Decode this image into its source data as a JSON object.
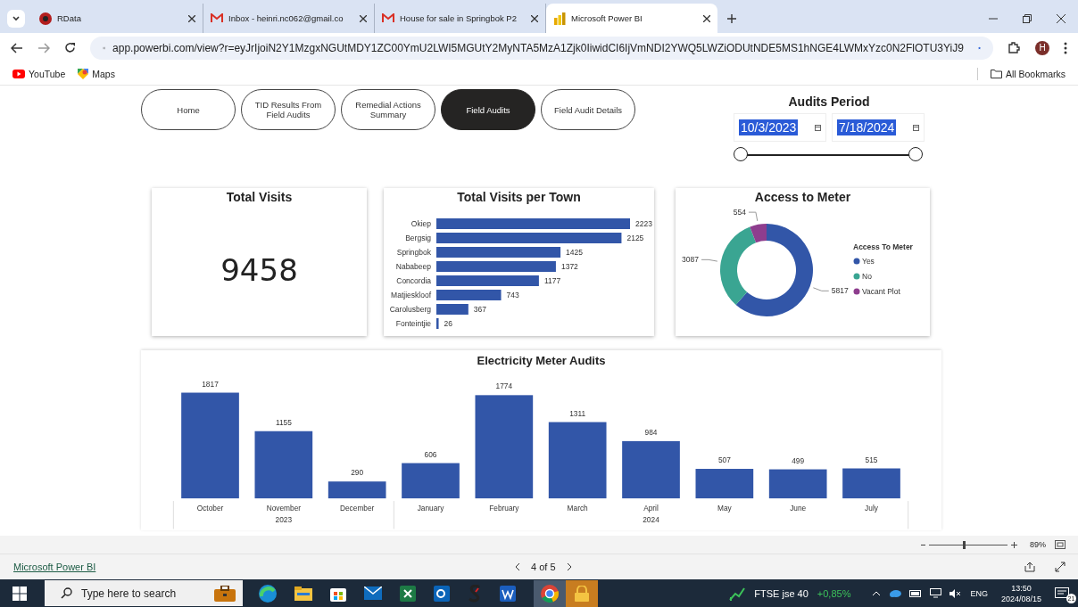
{
  "browser": {
    "tabs": [
      {
        "title": "RData",
        "selected": false
      },
      {
        "title": "Inbox - heinri.nc062@gmail.co",
        "selected": false
      },
      {
        "title": "House for sale in Springbok P2",
        "selected": false
      },
      {
        "title": "Microsoft Power BI",
        "selected": true
      }
    ],
    "url": "app.powerbi.com/view?r=eyJrIjoiN2Y1MzgxNGUtMDY1ZC00YmU2LWI5MGUtY2MyNTA5MzA1Zjk0IiwidCI6IjVmNDI2YWQ5LWZiODUtNDE5MS1hNGE4LWMxYzc0N2FlOTU3YiJ9",
    "profile_initial": "H",
    "bookmarks": [
      {
        "label": "YouTube"
      },
      {
        "label": "Maps"
      }
    ],
    "all_bookmarks": "All Bookmarks"
  },
  "nav_buttons": [
    {
      "label": "Home",
      "selected": false
    },
    {
      "label": "TID Results From Field Audits",
      "selected": false
    },
    {
      "label": "Remedial Actions Summary",
      "selected": false
    },
    {
      "label": "Field Audits",
      "selected": true
    },
    {
      "label": "Field Audit Details",
      "selected": false
    }
  ],
  "audits_period": {
    "title": "Audits Period",
    "start": "10/3/2023",
    "end": "7/18/2024",
    "handles": [
      {
        "level": 0
      },
      {
        "level": 1
      }
    ]
  },
  "total_visits": {
    "title": "Total Visits",
    "value": "9458"
  },
  "visits_per_town": {
    "title": "Total Visits per Town",
    "chart_data": {
      "type": "bar",
      "orientation": "horizontal",
      "data_labels": true,
      "categories": [
        "Okiep",
        "Bergsig",
        "Springbok",
        "Nababeep",
        "Concordia",
        "Matjieskloof",
        "Carolusberg",
        "Fonteintjie"
      ],
      "series": [
        {
          "color": "#3256a8",
          "values": [
            2223,
            2125,
            1425,
            1372,
            1177,
            743,
            367,
            26
          ]
        }
      ]
    }
  },
  "access_to_meter": {
    "title": "Access to Meter",
    "chart_data": {
      "type": "donut",
      "data_labels": true,
      "categories": [
        "Yes",
        "No",
        "Vacant Plot"
      ],
      "series": [
        {
          "values": [
            5817,
            3087,
            554
          ]
        }
      ],
      "colors": [
        "#3256a8",
        "#3aa592",
        "#8e3d8e"
      ],
      "legend": {
        "title": "Access To Meter"
      }
    }
  },
  "meter_audits": {
    "title": "Electricity Meter Audits",
    "year_groups": [
      {
        "label": "2023",
        "categories": [
          "October",
          "November",
          "December"
        ]
      },
      {
        "label": "2024",
        "categories": [
          "January",
          "February",
          "March",
          "April",
          "May",
          "June",
          "July"
        ]
      }
    ],
    "chart_data": {
      "type": "bar",
      "orientation": "vertical",
      "data_labels": true,
      "series": [
        {
          "color": "#3256a8",
          "values": [
            1817,
            1155,
            290,
            606,
            1774,
            1311,
            984,
            507,
            499,
            515
          ]
        }
      ]
    }
  },
  "zoom": {
    "value": "89%",
    "level": 0.45
  },
  "footer": {
    "brand": "Microsoft Power BI",
    "page": "4 of 5"
  },
  "taskbar": {
    "search_placeholder": "Type here to search",
    "ticker": "FTSE jse 40",
    "change": "+0,85%",
    "language": "ENG",
    "time": "13:50",
    "date": "2024/08/15",
    "notifications": "21"
  }
}
